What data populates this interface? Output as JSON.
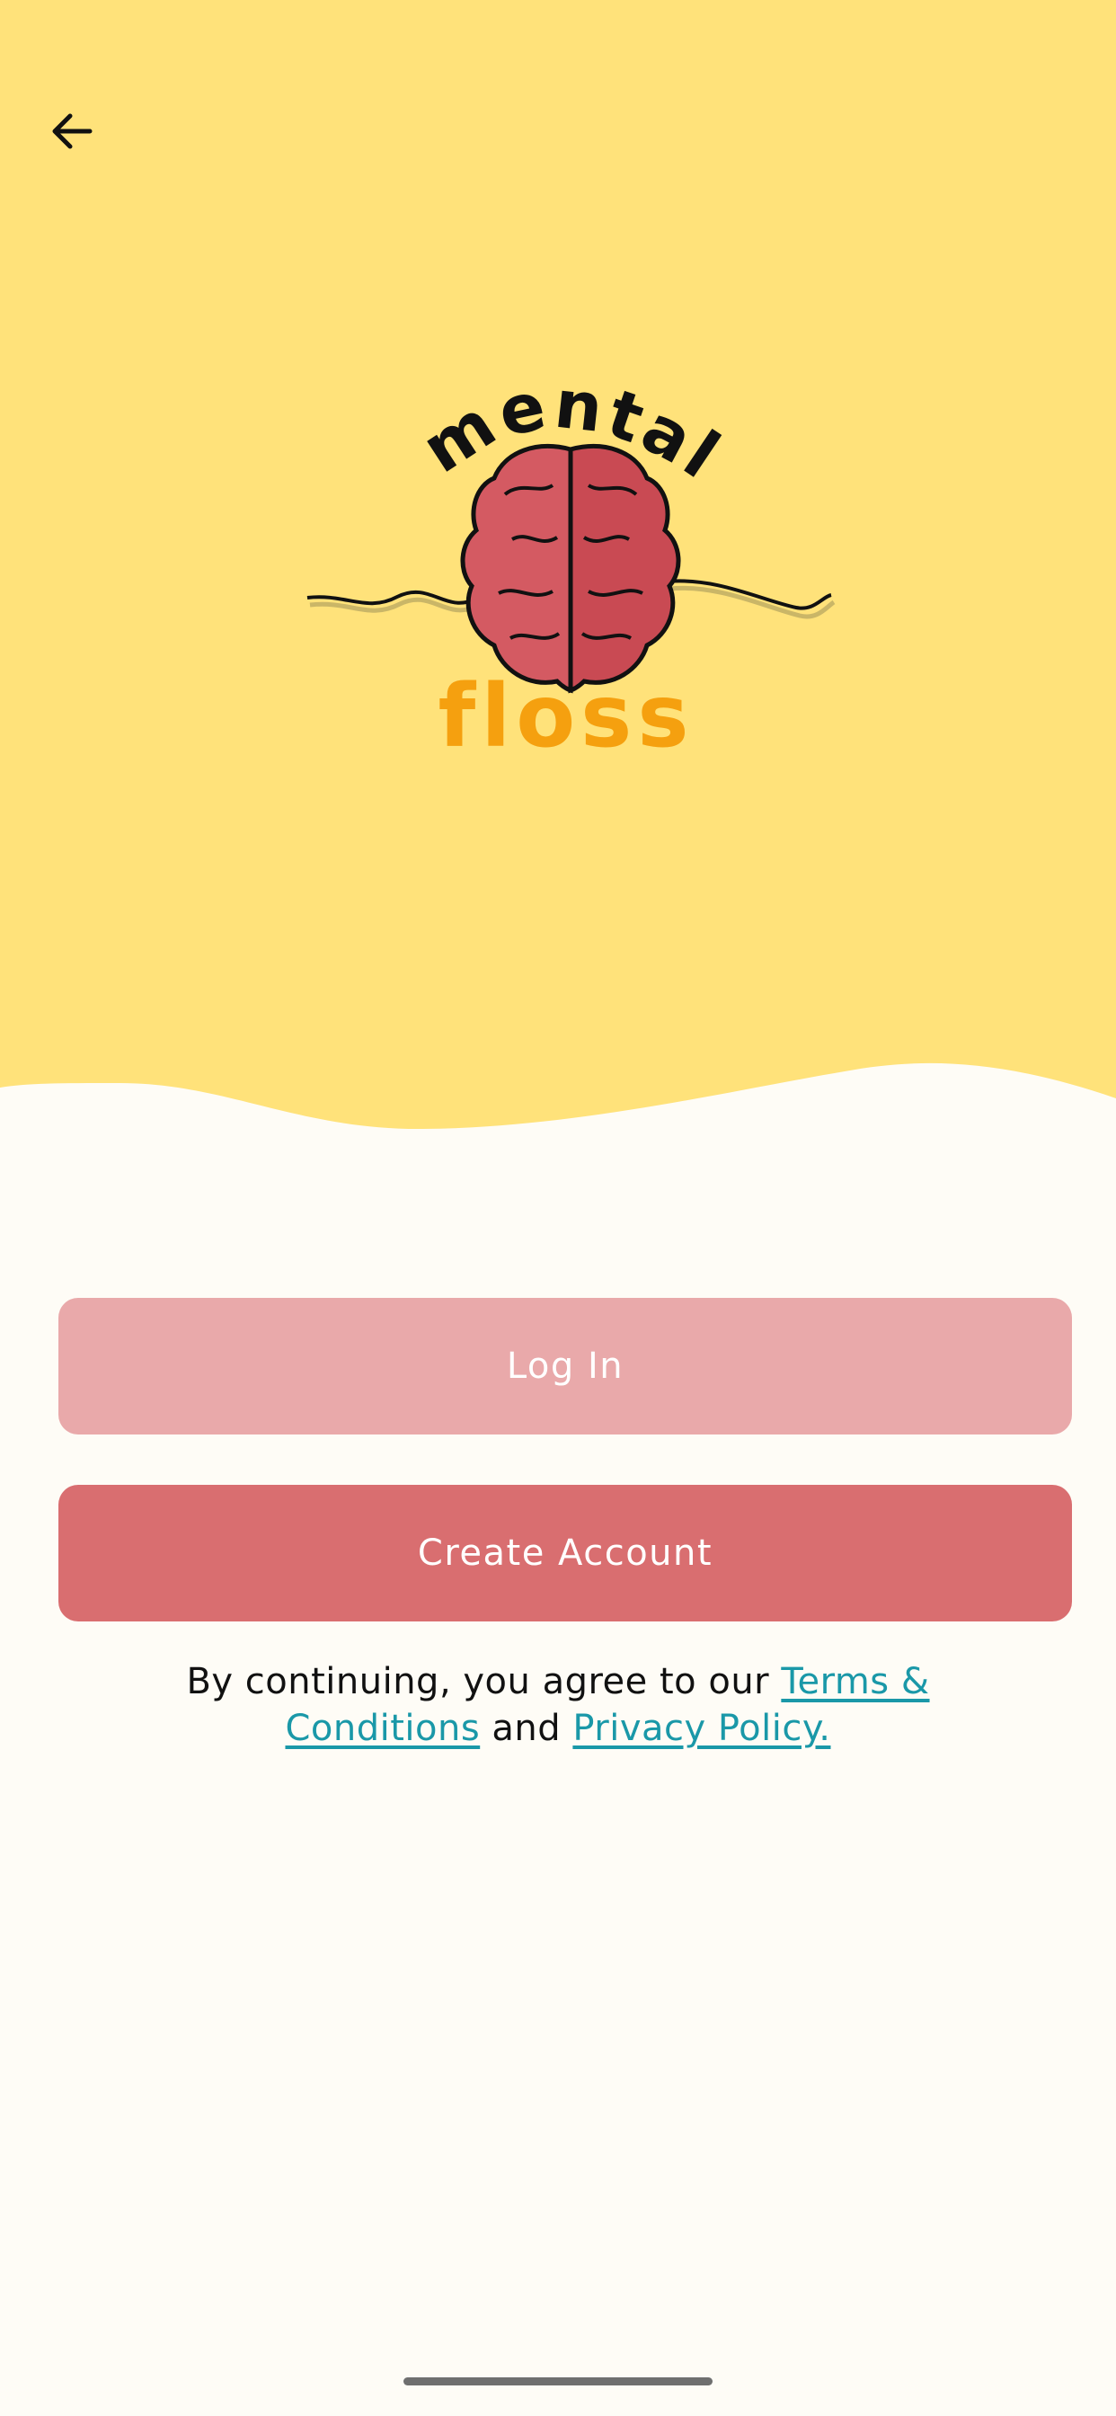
{
  "colors": {
    "header_background": "#ffe27a",
    "page_background": "#fefcf6",
    "login_button": "#e9a9aa",
    "create_account_button": "#d96e70",
    "link": "#1a98a8",
    "brain": "#d45a62",
    "logo_floss": "#f5a00f"
  },
  "header": {
    "back_icon": "arrow-left-icon"
  },
  "logo": {
    "line1": "mental",
    "line2": "floss"
  },
  "buttons": {
    "login_label": "Log In",
    "create_account_label": "Create Account"
  },
  "legal": {
    "prefix": "By continuing, you agree to our ",
    "terms_link": "Terms & Conditions",
    "middle": " and ",
    "privacy_link": "Privacy Policy."
  }
}
